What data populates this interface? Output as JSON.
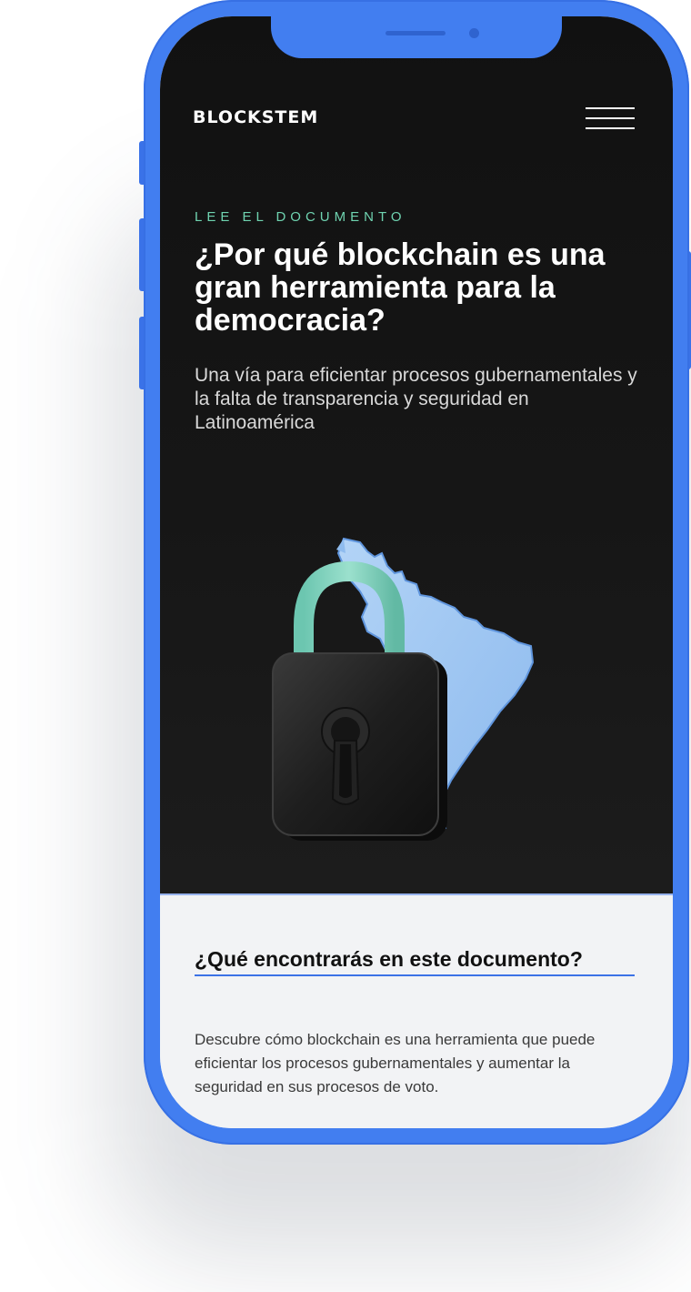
{
  "app": {
    "brand": "BLOCKSTEM"
  },
  "header": {
    "menu_icon": "hamburger-menu-icon"
  },
  "hero": {
    "eyebrow": "LEE EL DOCUMENTO",
    "title": "¿Por qué blockchain es una gran herramienta para la democracia?",
    "subtitle": "Una vía para eficientar procesos gubernamentales y la falta de transparencia y seguridad en Latinoamérica",
    "illustration_icon": "padlock-latin-america-icon"
  },
  "section": {
    "title": "¿Qué encontrarás en este documento?",
    "body": "Descubre cómo blockchain es una herramienta que puede eficientar los procesos gubernamentales y aumentar la seguridad en sus procesos de voto."
  },
  "colors": {
    "device_frame": "#427ef0",
    "dark_background": "#141414",
    "accent_green": "#6fd3b0",
    "accent_blue": "#3c72e6",
    "map_blue": "#9bc4f1",
    "padlock_shackle": "#7fd4bf"
  }
}
